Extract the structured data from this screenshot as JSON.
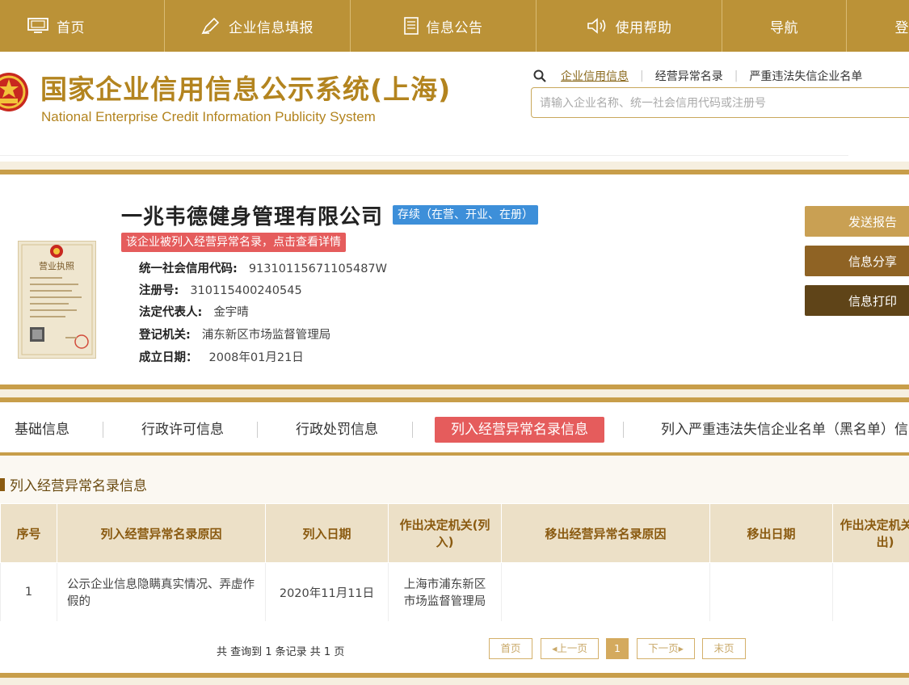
{
  "topnav": {
    "items": [
      {
        "label": "首页",
        "icon": "monitor-icon"
      },
      {
        "label": "企业信息填报",
        "icon": "edit-icon"
      },
      {
        "label": "信息公告",
        "icon": "document-icon"
      },
      {
        "label": "使用帮助",
        "icon": "speaker-icon"
      },
      {
        "label": "导航",
        "icon": ""
      },
      {
        "label": "登",
        "icon": ""
      }
    ]
  },
  "header": {
    "title": "国家企业信用信息公示系统(上海)",
    "subtitle": "National Enterprise Credit Information Publicity System",
    "search_tabs": [
      "企业信用信息",
      "经营异常名录",
      "严重违法失信企业名单"
    ],
    "search_placeholder": "请输入企业名称、统一社会信用代码或注册号"
  },
  "company": {
    "name": "一兆韦德健身管理有限公司",
    "status": "存续（在营、开业、在册）",
    "notice": "该企业被列入经营异常名录，点击查看详情",
    "fields": [
      {
        "label": "统一社会信用代码:",
        "value": "91310115671105487W"
      },
      {
        "label": "注册号:",
        "value": "310115400240545"
      },
      {
        "label": "法定代表人:",
        "value": "金宇晴"
      },
      {
        "label": "登记机关:",
        "value": "浦东新区市场监督管理局"
      },
      {
        "label": "成立日期：",
        "value": "2008年01月21日"
      }
    ],
    "actions": [
      "发送报告",
      "信息分享",
      "信息打印"
    ],
    "license_label": "营业执照"
  },
  "tabs": [
    "基础信息",
    "行政许可信息",
    "行政处罚信息",
    "列入经营异常名录信息",
    "列入严重违法失信企业名单（黑名单）信"
  ],
  "section": {
    "title": "列入经营异常名录信息",
    "columns": [
      "序号",
      "列入经营异常名录原因",
      "列入日期",
      "作出决定机关(列入)",
      "移出经营异常名录原因",
      "移出日期",
      "作出决定机关(移出)"
    ],
    "rows": [
      [
        "1",
        "公示企业信息隐瞒真实情况、弄虚作假的",
        "2020年11月11日",
        "上海市浦东新区市场监督管理局",
        "",
        "",
        ""
      ]
    ]
  },
  "pager": {
    "summary": "共 查询到 1 条记录 共 1 页",
    "first": "首页",
    "prev": "上一页",
    "current": "1",
    "next": "下一页",
    "last": "末页"
  },
  "colors": {
    "gold": "#bb9237",
    "accent_red": "#e55c5c",
    "status_blue": "#3d8fd9",
    "btn1": "#c9a053",
    "btn2": "#8f6324",
    "btn3": "#5f4418"
  }
}
